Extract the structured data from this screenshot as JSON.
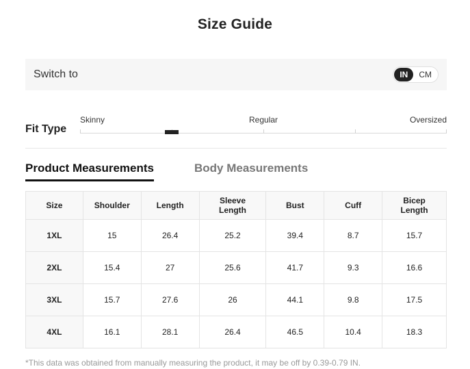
{
  "title": "Size Guide",
  "switch": {
    "label": "Switch to",
    "options": [
      "IN",
      "CM"
    ],
    "selected": "IN"
  },
  "fit": {
    "title": "Fit Type",
    "labels": {
      "left": "Skinny",
      "middle": "Regular",
      "right": "Oversized"
    }
  },
  "tabs": {
    "product": "Product Measurements",
    "body": "Body Measurements",
    "active": "product"
  },
  "table": {
    "headers": [
      "Size",
      "Shoulder",
      "Length",
      "Sleeve\nLength",
      "Bust",
      "Cuff",
      "Bicep\nLength"
    ],
    "rows": [
      [
        "1XL",
        "15",
        "26.4",
        "25.2",
        "39.4",
        "8.7",
        "15.7"
      ],
      [
        "2XL",
        "15.4",
        "27",
        "25.6",
        "41.7",
        "9.3",
        "16.6"
      ],
      [
        "3XL",
        "15.7",
        "27.6",
        "26",
        "44.1",
        "9.8",
        "17.5"
      ],
      [
        "4XL",
        "16.1",
        "28.1",
        "26.4",
        "46.5",
        "10.4",
        "18.3"
      ]
    ]
  },
  "note": "*This data was obtained from manually measuring the product, it may be off by 0.39-0.79 IN."
}
